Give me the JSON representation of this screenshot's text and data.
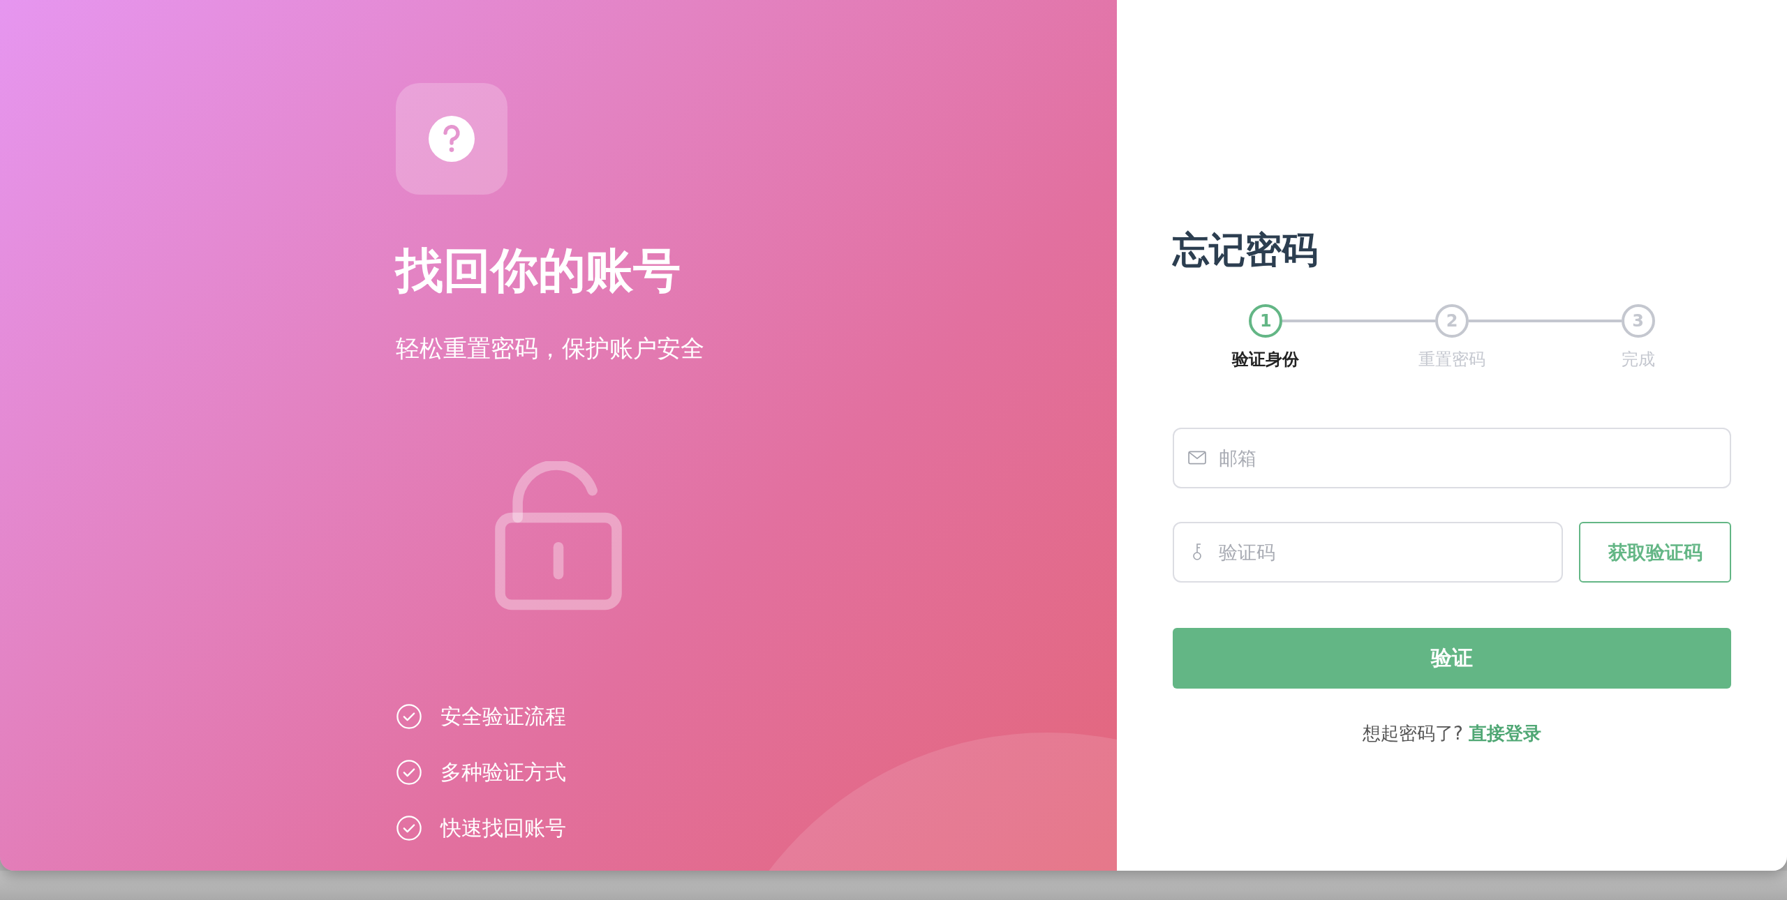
{
  "hero": {
    "title": "找回你的账号",
    "subtitle": "轻松重置密码，保护账户安全",
    "features": [
      "安全验证流程",
      "多种验证方式",
      "快速找回账号"
    ]
  },
  "form": {
    "title": "忘记密码",
    "steps": [
      {
        "number": "1",
        "label": "验证身份",
        "selected": true
      },
      {
        "number": "2",
        "label": "重置密码",
        "selected": false
      },
      {
        "number": "3",
        "label": "完成",
        "selected": false
      }
    ],
    "email": {
      "placeholder": "邮箱"
    },
    "code": {
      "placeholder": "验证码"
    },
    "send_code_button": "获取验证码",
    "submit_button": "验证",
    "footer": {
      "text": "想起密码了?",
      "link": "直接登录"
    }
  }
}
